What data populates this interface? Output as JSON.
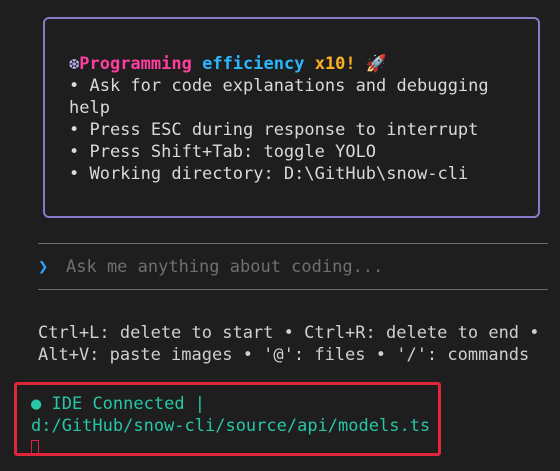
{
  "welcome": {
    "sparkle_icon": "❆",
    "title_segments": [
      "Programming",
      "efficiency",
      "x10!"
    ],
    "rocket_icon": "🚀",
    "lines": [
      "• Ask for code explanations and debugging",
      "help",
      "• Press ESC during response to interrupt",
      "• Press Shift+Tab: toggle YOLO",
      "• Working directory: D:\\GitHub\\snow-cli"
    ]
  },
  "prompt": {
    "chevron": "❯",
    "placeholder": "Ask me anything about coding..."
  },
  "hints": {
    "line1": "Ctrl+L: delete to start • Ctrl+R: delete to end •",
    "line2": "Alt+V: paste images • '@': files • '/': commands"
  },
  "ide": {
    "status_dot": "●",
    "status_text": "IDE Connected |",
    "file_path": "d:/GitHub/snow-cli/source/api/models.ts"
  },
  "colors": {
    "title_programming": "#ff3fa0",
    "title_efficiency": "#2ab7ff",
    "title_x10": "#ffb020",
    "welcome_border": "#8a78c9",
    "ide_text": "#27c6a6",
    "highlight_border": "#e0263b"
  }
}
